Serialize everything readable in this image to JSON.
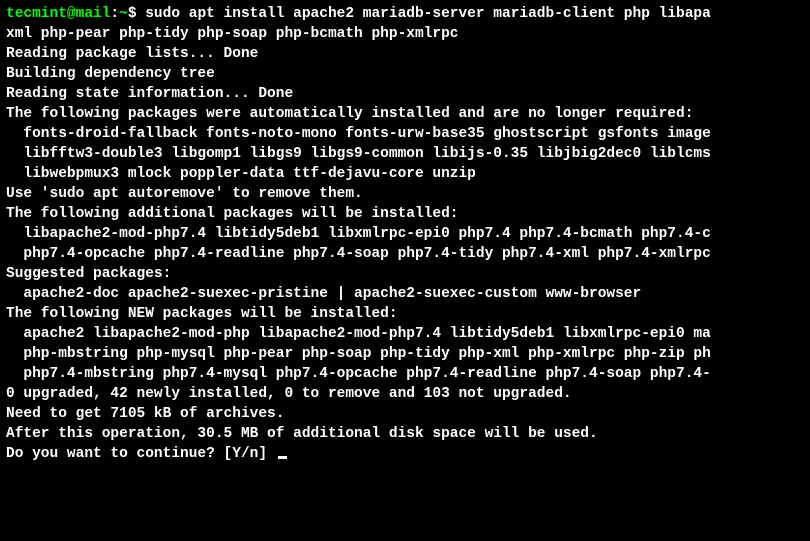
{
  "prompt": {
    "user_host": "tecmint@mail",
    "separator": ":",
    "path": "~",
    "symbol": "$ ",
    "command": "sudo apt install apache2 mariadb-server mariadb-client php libapa"
  },
  "lines": [
    "xml php-pear php-tidy php-soap php-bcmath php-xmlrpc",
    "Reading package lists... Done",
    "Building dependency tree",
    "Reading state information... Done",
    "The following packages were automatically installed and are no longer required:",
    "  fonts-droid-fallback fonts-noto-mono fonts-urw-base35 ghostscript gsfonts image",
    "  libfftw3-double3 libgomp1 libgs9 libgs9-common libijs-0.35 libjbig2dec0 liblcms",
    "  libwebpmux3 mlock poppler-data ttf-dejavu-core unzip",
    "Use 'sudo apt autoremove' to remove them.",
    "The following additional packages will be installed:",
    "  libapache2-mod-php7.4 libtidy5deb1 libxmlrpc-epi0 php7.4 php7.4-bcmath php7.4-c",
    "  php7.4-opcache php7.4-readline php7.4-soap php7.4-tidy php7.4-xml php7.4-xmlrpc",
    "Suggested packages:",
    "  apache2-doc apache2-suexec-pristine | apache2-suexec-custom www-browser",
    "The following NEW packages will be installed:",
    "  apache2 libapache2-mod-php libapache2-mod-php7.4 libtidy5deb1 libxmlrpc-epi0 ma",
    "  php-mbstring php-mysql php-pear php-soap php-tidy php-xml php-xmlrpc php-zip ph",
    "  php7.4-mbstring php7.4-mysql php7.4-opcache php7.4-readline php7.4-soap php7.4-",
    "0 upgraded, 42 newly installed, 0 to remove and 103 not upgraded.",
    "Need to get 7105 kB of archives.",
    "After this operation, 30.5 MB of additional disk space will be used.",
    "Do you want to continue? [Y/n] "
  ]
}
